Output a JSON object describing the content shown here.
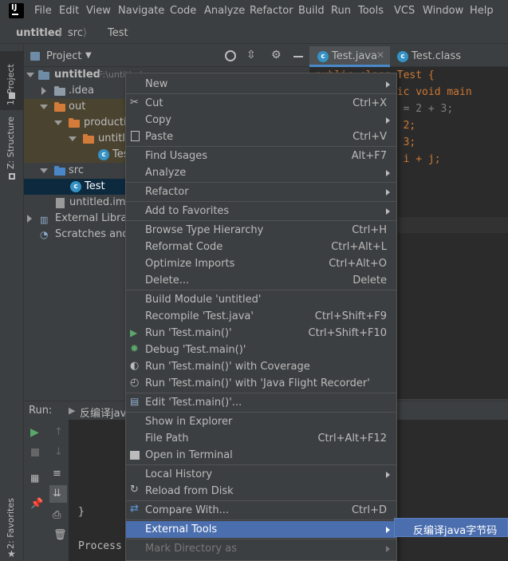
{
  "menubar": {
    "items": [
      "File",
      "Edit",
      "View",
      "Navigate",
      "Code",
      "Analyze",
      "Refactor",
      "Build",
      "Run",
      "Tools",
      "VCS",
      "Window",
      "Help"
    ]
  },
  "breadcrumb": {
    "project": "untitled",
    "folder": "src",
    "file": "Test"
  },
  "left_strip": {
    "project_tab": "1: Project",
    "structure_tab": "Z: Structure",
    "favorites_tab": "2: Favorites"
  },
  "project_panel": {
    "title": "Project",
    "tree": {
      "root": "untitled",
      "root_path": "F:\\untitled",
      "idea": ".idea",
      "out": "out",
      "production": "production",
      "out_untitled": "untitled",
      "test_class": "Test",
      "src": "src",
      "test": "Test",
      "iml": "untitled.iml",
      "ext_libs": "External Libraries",
      "scratches": "Scratches and Consoles"
    }
  },
  "editor": {
    "tabs": [
      "Test.java",
      "Test.class"
    ],
    "code": [
      "public class Test {",
      "  public static void main",
      "      //int i = 2 + 3;",
      "      int i = 2;",
      "      int j = 3;",
      "      int k = i + j;"
    ]
  },
  "run_panel": {
    "label": "Run:",
    "tab": "反编译java字节码",
    "console": [
      "}",
      "Process"
    ]
  },
  "context_menu": {
    "new": "New",
    "cut": "Cut",
    "cut_sc": "Ctrl+X",
    "copy": "Copy",
    "paste": "Paste",
    "paste_sc": "Ctrl+V",
    "find_usages": "Find Usages",
    "find_usages_sc": "Alt+F7",
    "analyze": "Analyze",
    "refactor": "Refactor",
    "add_fav": "Add to Favorites",
    "browse_hier": "Browse Type Hierarchy",
    "browse_hier_sc": "Ctrl+H",
    "reformat": "Reformat Code",
    "reformat_sc": "Ctrl+Alt+L",
    "optimize": "Optimize Imports",
    "optimize_sc": "Ctrl+Alt+O",
    "delete": "Delete...",
    "delete_sc": "Delete",
    "build_module": "Build Module 'untitled'",
    "recompile": "Recompile 'Test.java'",
    "recompile_sc": "Ctrl+Shift+F9",
    "run_main": "Run 'Test.main()'",
    "run_main_sc": "Ctrl+Shift+F10",
    "debug_main": "Debug 'Test.main()'",
    "run_coverage": "Run 'Test.main()' with Coverage",
    "run_jfr": "Run 'Test.main()' with 'Java Flight Recorder'",
    "edit_main": "Edit 'Test.main()'...",
    "show_explorer": "Show in Explorer",
    "file_path": "File Path",
    "file_path_sc": "Ctrl+Alt+F12",
    "open_terminal": "Open in Terminal",
    "local_history": "Local History",
    "reload": "Reload from Disk",
    "compare": "Compare With...",
    "compare_sc": "Ctrl+D",
    "external_tools": "External Tools",
    "mark_dir": "Mark Directory as"
  },
  "submenu": {
    "item": "反编译java字节码"
  },
  "colors": {
    "highlight": "#4b6eaf",
    "background": "#3c3f41",
    "editor_bg": "#2b2b2b",
    "keyword": "#cc7832",
    "number": "#6897bb"
  }
}
